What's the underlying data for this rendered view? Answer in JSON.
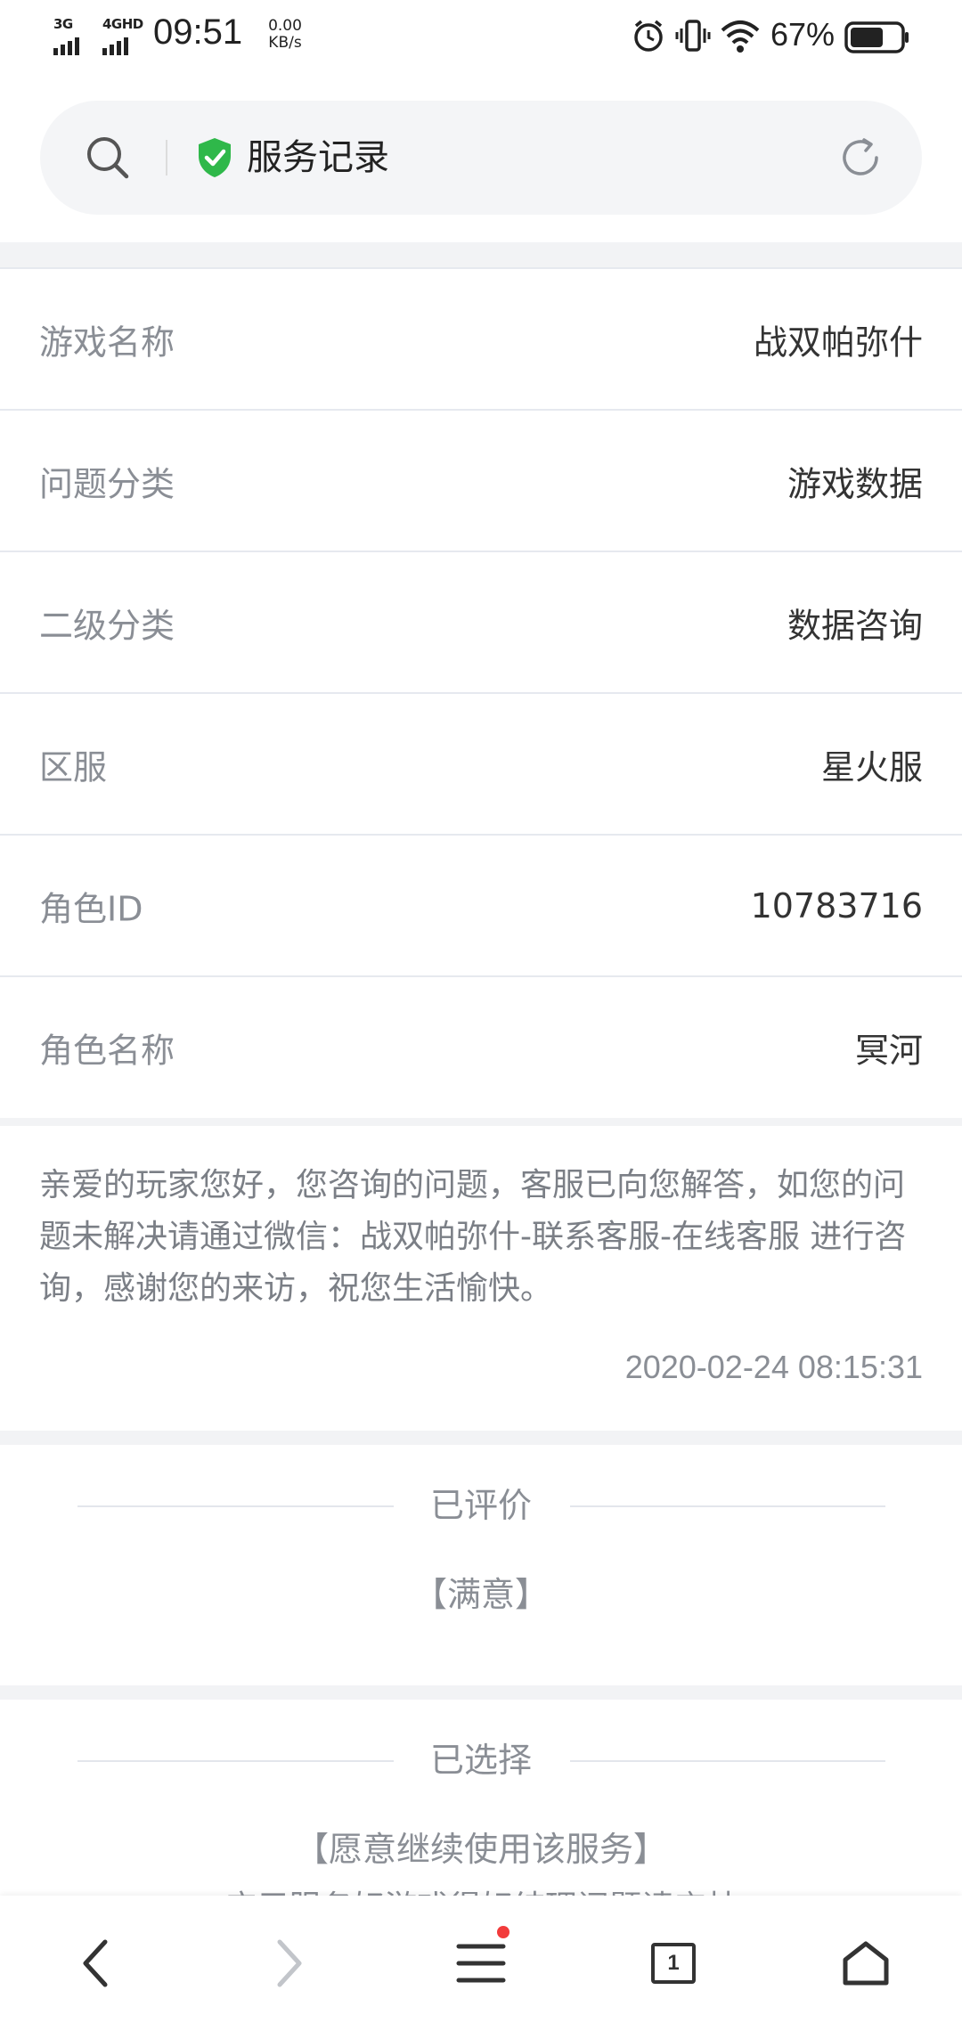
{
  "status_bar": {
    "network_1": "3G",
    "network_2": "4GHD",
    "time": "09:51",
    "speed_value": "0.00",
    "speed_unit": "KB/s",
    "battery": "67%",
    "icons": [
      "alarm-icon",
      "vibrate-icon",
      "wifi-icon",
      "battery-icon"
    ]
  },
  "header": {
    "title": "服务记录",
    "icons": [
      "search-icon",
      "shield-check-icon",
      "refresh-icon"
    ],
    "shield_color": "#2fb84a"
  },
  "info": {
    "rows": [
      {
        "label": "游戏名称",
        "value": "战双帕弥什"
      },
      {
        "label": "问题分类",
        "value": "游戏数据"
      },
      {
        "label": "二级分类",
        "value": "数据咨询"
      },
      {
        "label": "区服",
        "value": "星火服"
      },
      {
        "label": "角色ID",
        "value": "10783716"
      },
      {
        "label": "角色名称",
        "value": "冥河"
      }
    ]
  },
  "message": {
    "text": "亲爱的玩家您好，您咨询的问题，客服已向您解答，如您的问题未解决请通过微信：战双帕弥什-联系客服-在线客服 进行咨询，感谢您的来访，祝您生活愉快。",
    "time": "2020-02-24 08:15:31"
  },
  "rating": {
    "title": "已评价",
    "value": "【满意】"
  },
  "choice": {
    "title": "已选择",
    "value": "【愿意继续使用该服务】",
    "subtext": "应用服务好游戏得好结理问题请応林"
  },
  "bottom_nav": {
    "tab_count": "1",
    "badge_color": "#f23b3b",
    "icons": [
      "back-icon",
      "forward-icon",
      "menu-icon",
      "tabs-icon",
      "home-icon"
    ]
  }
}
